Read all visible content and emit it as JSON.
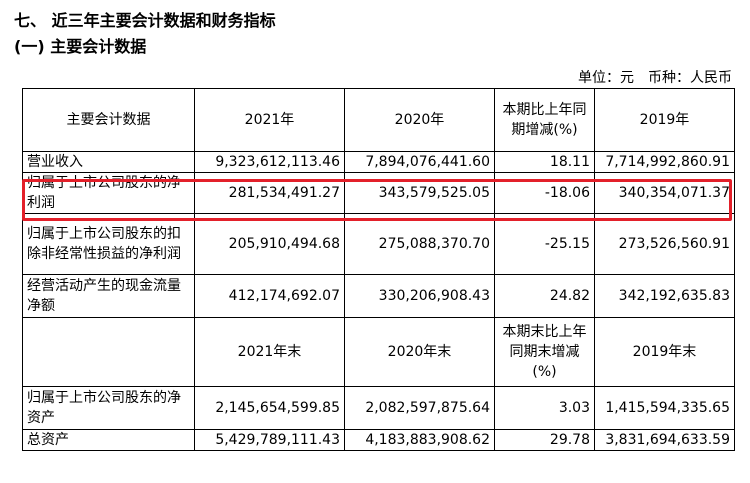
{
  "heading": {
    "section": "七、 近三年主要会计数据和财务指标",
    "subsection": "(一) 主要会计数据",
    "unit_note": "单位：元　币种：人民币"
  },
  "table": {
    "header1": {
      "label": "主要会计数据",
      "y2021": "2021年",
      "y2020": "2020年",
      "change": "本期比上年同期增减(%)",
      "y2019": "2019年"
    },
    "rows1": [
      {
        "label": "营业收入",
        "v2021": "9,323,612,113.46",
        "v2020": "7,894,076,441.60",
        "change": "18.11",
        "v2019": "7,714,992,860.91"
      },
      {
        "label": "归属于上市公司股东的净利润",
        "v2021": "281,534,491.27",
        "v2020": "343,579,525.05",
        "change": "-18.06",
        "v2019": "340,354,071.37"
      },
      {
        "label": "归属于上市公司股东的扣除非经常性损益的净利润",
        "v2021": "205,910,494.68",
        "v2020": "275,088,370.70",
        "change": "-25.15",
        "v2019": "273,526,560.91"
      },
      {
        "label": "经营活动产生的现金流量净额",
        "v2021": "412,174,692.07",
        "v2020": "330,206,908.43",
        "change": "24.82",
        "v2019": "342,192,635.83"
      }
    ],
    "header2": {
      "y2021": "2021年末",
      "y2020": "2020年末",
      "change": "本期末比上年同期末增减(%)",
      "y2019": "2019年末"
    },
    "rows2": [
      {
        "label": "归属于上市公司股东的净资产",
        "v2021": "2,145,654,599.85",
        "v2020": "2,082,597,875.64",
        "change": "3.03",
        "v2019": "1,415,594,335.65"
      },
      {
        "label": "总资产",
        "v2021": "5,429,789,111.43",
        "v2020": "4,183,883,908.62",
        "change": "29.78",
        "v2019": "3,831,694,633.59"
      }
    ]
  },
  "highlight_color": "#e3202a"
}
